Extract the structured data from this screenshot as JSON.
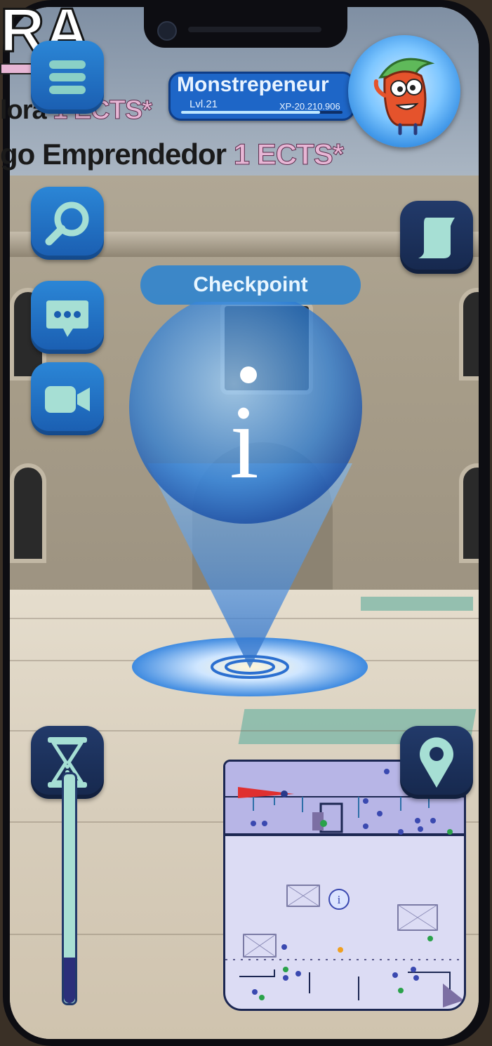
{
  "overlay": {
    "title_fragment": "RA",
    "line1_text": "lora ",
    "line1_credit": "1 ECTS*",
    "line2_text": "go Emprendedor ",
    "line2_credit": "1 ECTS*"
  },
  "profile": {
    "name": "Monstrepeneur",
    "level": "Lvl.21",
    "xp": "XP-20.210.906",
    "xp_fraction": 0.86
  },
  "checkpoint": {
    "label": "Checkpoint",
    "marker_glyph": "i"
  },
  "minimap": {
    "info_glyph": "i"
  },
  "timer": {
    "level": 0.2
  },
  "icons": {
    "menu": "menu-icon",
    "search": "search-icon",
    "chat": "chat-bubble-icon",
    "video": "video-camera-icon",
    "scroll": "scroll-icon",
    "hourglass": "hourglass-icon",
    "location": "location-pin-icon"
  },
  "colors": {
    "button_blue": "#1f74c9",
    "button_dark": "#1b2f5a",
    "accent_pink": "#e7b6d5",
    "timer_track": "#a9dfd4",
    "marker_blue": "#3e9ae6"
  }
}
